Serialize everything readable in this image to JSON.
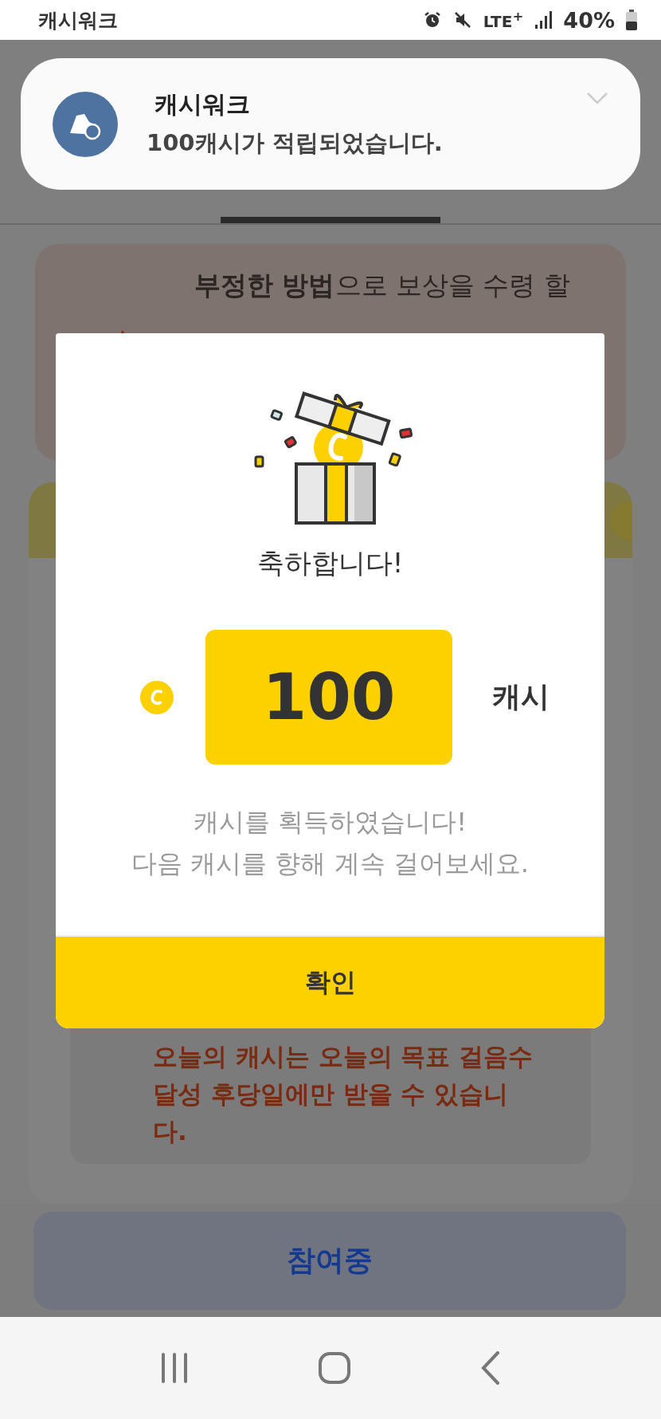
{
  "status_bar": {
    "app": "캐시워크",
    "network": "LTE$^{+}$",
    "battery": "40%"
  },
  "notification": {
    "app": "캐시워크",
    "message": "100캐시가 적립되었습니다."
  },
  "warning_card": {
    "lines": [
      "**부정한 방법**으로 보상을 수령 할"
    ]
  },
  "notice": {
    "lines": [
      "오늘의 캐시는 오늘의 목표 걸음수",
      "달성 후당일에만 받을 수 있습니",
      "다."
    ]
  },
  "join_button": {
    "label": "참여중"
  },
  "dialog": {
    "title": "축하합니다!",
    "amount": "100",
    "unit": "캐시",
    "message": [
      "캐시를 획득하였습니다!",
      "다음 캐시를 향해 계속 걸어보세요."
    ],
    "confirm": "확인"
  }
}
